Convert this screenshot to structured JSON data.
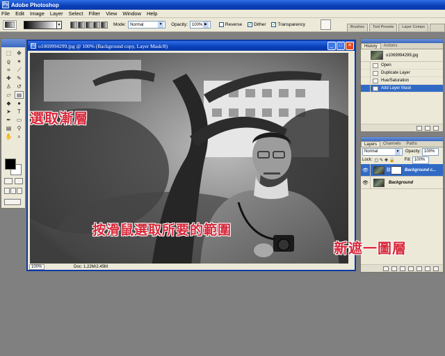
{
  "app": {
    "title": "Adobe Photoshop",
    "icon": "photoshop-icon"
  },
  "menu": [
    "File",
    "Edit",
    "Image",
    "Layer",
    "Select",
    "Filter",
    "View",
    "Window",
    "Help"
  ],
  "options": {
    "mode_label": "Mode:",
    "mode_value": "Normal",
    "opacity_label": "Opacity:",
    "opacity_value": "100%",
    "reverse_label": "Reverse",
    "reverse_checked": false,
    "dither_label": "Dither",
    "dither_checked": true,
    "transparency_label": "Transparency",
    "transparency_checked": true
  },
  "palette_well": [
    "Brushes",
    "Tool Presets",
    "Layer Comps"
  ],
  "document": {
    "title": "o1069994299.jpg @ 100% (Background copy, Layer Mask/8)",
    "zoom": "100%",
    "doc_info": "Doc: 1.22M/2.45M"
  },
  "annotations": {
    "top_left": "選取漸層",
    "center": "按滑鼠選取所要的範圍",
    "bottom_right": "新遮一圖層"
  },
  "history_panel": {
    "tabs": [
      "History",
      "Actions"
    ],
    "snapshot": "o1069994299.jpg",
    "steps": [
      "Open",
      "Duplicate Layer",
      "Hue/Saturation",
      "Add Layer Mask"
    ],
    "active_step": 3
  },
  "layers_panel": {
    "tabs": [
      "Layers",
      "Channels",
      "Paths"
    ],
    "blend_mode": "Normal",
    "opacity_label": "Opacity:",
    "opacity_value": "100%",
    "lock_label": "Lock:",
    "fill_label": "Fill:",
    "fill_value": "100%",
    "layers": [
      {
        "name": "Background c...",
        "active": true
      },
      {
        "name": "Background",
        "active": false
      }
    ]
  },
  "colors": {
    "accent_blue": "#0b3aa6",
    "annotation_red": "#d8283a",
    "selected_row": "#316ac5"
  }
}
